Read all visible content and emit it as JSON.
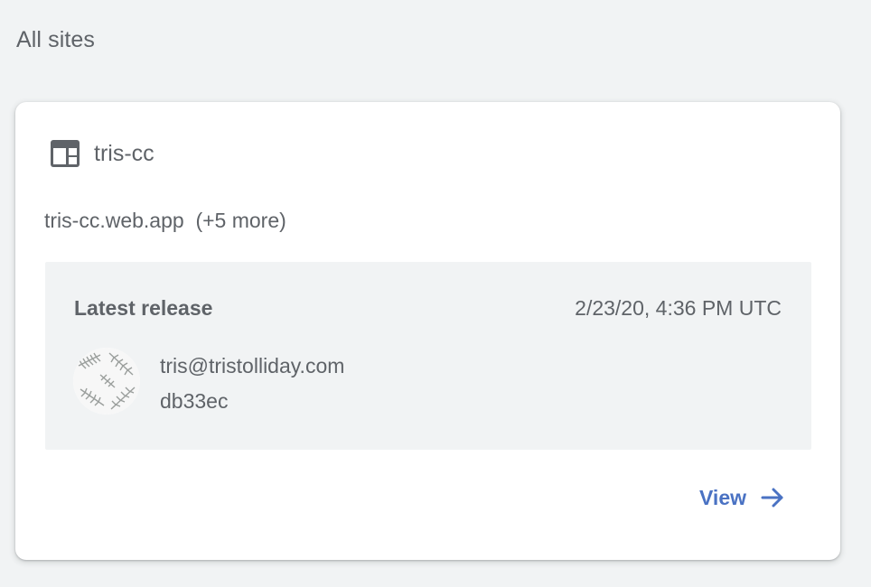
{
  "section": {
    "title": "All sites"
  },
  "site": {
    "icon": "web-layout-icon",
    "name": "tris-cc",
    "domains": "tris-cc.web.app  (+5 more)",
    "release": {
      "label": "Latest release",
      "timestamp": "2/23/20, 4:36 PM UTC",
      "author": "tris@tristolliday.com",
      "commit": "db33ec",
      "avatar_icon": "fern-avatar"
    },
    "view": {
      "label": "View",
      "icon": "arrow-right-icon"
    }
  },
  "colors": {
    "background": "#f1f3f4",
    "card": "#ffffff",
    "text": "#5f6368",
    "link": "#4a72c3"
  }
}
